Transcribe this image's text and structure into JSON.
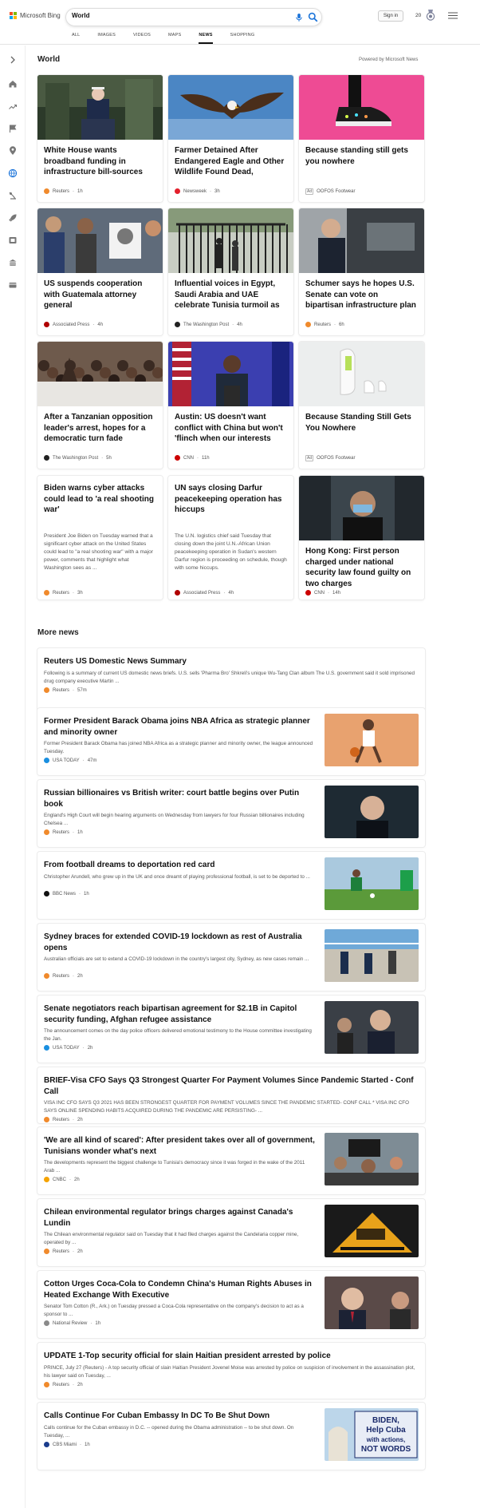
{
  "header": {
    "brand": "Microsoft Bing",
    "query": "World",
    "sign_in": "Sign in",
    "points": "20",
    "tabs": [
      {
        "label": "ALL",
        "active": false
      },
      {
        "label": "IMAGES",
        "active": false
      },
      {
        "label": "VIDEOS",
        "active": false
      },
      {
        "label": "MAPS",
        "active": false
      },
      {
        "label": "NEWS",
        "active": true
      },
      {
        "label": "SHOPPING",
        "active": false
      }
    ]
  },
  "sidebar": {
    "icons": [
      "expand-icon",
      "home-icon",
      "trending-icon",
      "flag-icon",
      "location-icon",
      "globe-icon",
      "science-icon",
      "rocket-icon",
      "film-icon",
      "building-icon",
      "card-icon"
    ],
    "active_index": 5
  },
  "world": {
    "heading": "World",
    "powered_by": "Powered by Microsoft News",
    "cards": [
      {
        "title": "White House wants broadband funding in infrastructure bill-sources",
        "source": "Reuters",
        "time": "1h",
        "badge": "#f08a2c",
        "image": "podium-speaker-image"
      },
      {
        "title": "Farmer Detained After Endangered Eagle and Other Wildlife Found Dead, Poisoned",
        "source": "Newsweek",
        "time": "3h",
        "badge": "#e3202c",
        "image": "eagle-image"
      },
      {
        "title": "Because standing still gets you nowhere",
        "source": "OOFOS Footwear",
        "time": "",
        "ad": "Ad",
        "image": "sneaker-image"
      },
      {
        "title": "US suspends cooperation with Guatemala attorney general",
        "source": "Associated Press",
        "time": "4h",
        "badge": "#b00000",
        "image": "protest-crowd-image"
      },
      {
        "title": "Influential voices in Egypt, Saudi Arabia and UAE celebrate Tunisia turmoil as blow to...",
        "source": "The Washington Post",
        "time": "4h",
        "badge": "#222222",
        "image": "gate-crowd-image"
      },
      {
        "title": "Schumer says he hopes U.S. Senate can vote on bipartisan infrastructure plan by week's...",
        "source": "Reuters",
        "time": "6h",
        "badge": "#f08a2c",
        "image": "senator-car-image"
      },
      {
        "title": "After a Tanzanian opposition leader's arrest, hopes for a democratic turn fade",
        "source": "The Washington Post",
        "time": "5h",
        "badge": "#222222",
        "image": "rally-crowd-image"
      },
      {
        "title": "Austin: US doesn't want conflict with China but won't 'flinch when our interests are...",
        "source": "CNN",
        "time": "11h",
        "badge": "#cc0000",
        "image": "general-flags-image"
      },
      {
        "title": "Because Standing Still Gets You Nowhere",
        "source": "OOFOS Footwear",
        "time": "",
        "ad": "Ad",
        "image": "white-shoes-image"
      },
      {
        "title": "Biden warns cyber attacks could lead to 'a real shooting war'",
        "desc": "President Joe Biden on Tuesday warned that a significant cyber attack on the United States could lead to \"a real shooting war\" with a major power, comments that highlight what Washington sees as ...",
        "source": "Reuters",
        "time": "3h",
        "badge": "#f08a2c"
      },
      {
        "title": "UN says closing Darfur peacekeeping operation has hiccups",
        "desc": "The U.N. logistics chief said Tuesday that closing down the joint U.N.-African Union peacekeeping operation in Sudan's western Darfur region is proceeding on schedule, though with some hiccups.",
        "source": "Associated Press",
        "time": "4h",
        "badge": "#b00000"
      },
      {
        "title": "Hong Kong: First person charged under national security law found guilty on two charges",
        "source": "CNN",
        "time": "14h",
        "badge": "#cc0000",
        "image": "masked-man-image"
      }
    ]
  },
  "more_news": {
    "heading": "More news",
    "items": [
      {
        "title": "Reuters US Domestic News Summary",
        "desc": "Following is a summary of current US domestic news briefs. U.S. sells 'Pharma Bro' Shkreli's unique Wu-Tang Clan album The U.S. government said it sold imprisoned drug company executive Martin ...",
        "source": "Reuters",
        "time": "57m",
        "badge": "#f08a2c"
      },
      {
        "title": "Former President Barack Obama joins NBA Africa as strategic planner and minority owner",
        "desc": "Former President Barack Obama has joined NBA Africa as a strategic planner and minority owner, the league announced Tuesday.",
        "source": "USA TODAY",
        "time": "47m",
        "badge": "#1a8fe0",
        "image": "basketball-image"
      },
      {
        "title": "Russian billionaires vs British writer: court battle begins over Putin book",
        "desc": "England's High Court will begin hearing arguments on Wednesday from lawyers for four Russian billionaires including Chelsea ...",
        "source": "Reuters",
        "time": "1h",
        "badge": "#f08a2c",
        "image": "billionaire-portrait-image"
      },
      {
        "title": "From football dreams to deportation red card",
        "desc": "Christopher Arundell, who grew up in the UK and once dreamt of playing professional football, is set to be deported to ...",
        "source": "BBC News",
        "time": "1h",
        "badge": "#111111",
        "image": "football-image"
      },
      {
        "title": "Sydney braces for extended COVID-19 lockdown as rest of Australia opens",
        "desc": "Australian officials are set to extend a COVID-19 lockdown in the country's largest city, Sydney, as new cases remain ...",
        "source": "Reuters",
        "time": "2h",
        "badge": "#f08a2c",
        "image": "beach-police-image"
      },
      {
        "title": "Senate negotiators reach bipartisan agreement for $2.1B in Capitol security funding, Afghan refugee assistance",
        "desc": "The announcement comes on the day police officers delivered emotional testimony to the House committee investigating the Jan.",
        "source": "USA TODAY",
        "time": "2h",
        "badge": "#1a8fe0",
        "image": "capitol-press-image"
      },
      {
        "title": "BRIEF-Visa CFO Says Q3 Strongest Quarter For Payment Volumes Since Pandemic Started - Conf Call",
        "desc": "VISA INC CFO SAYS Q3 2021 HAS BEEN STRONGEST QUARTER FOR PAYMENT VOLUMES SINCE THE PANDEMIC STARTED- CONF CALL * VISA INC CFO SAYS ONLINE SPENDING HABITS ACQUIRED DURING THE PANDEMIC ARE PERSISTING- ...",
        "source": "Reuters",
        "time": "2h",
        "badge": "#f08a2c"
      },
      {
        "title": "'We are all kind of scared': After president takes over all of government, Tunisians wonder what's next",
        "desc": "The developments represent the biggest challenge to Tunisia's democracy since it was forged in the wake of the 2011 Arab ...",
        "source": "CNBC",
        "time": "2h",
        "badge": "#f5a300",
        "image": "tunisia-protest-image"
      },
      {
        "title": "Chilean environmental regulator brings charges against Canada's Lundin",
        "desc": "The Chilean environmental regulator said on Tuesday that it had filed charges against the Candelaria copper mine, operated by ...",
        "source": "Reuters",
        "time": "2h",
        "badge": "#f08a2c",
        "image": "mine-truck-image"
      },
      {
        "title": "Cotton Urges Coca-Cola to Condemn China's Human Rights Abuses in Heated Exchange With Executive",
        "desc": "Senator Tom Cotton (R., Ark.) on Tuesday pressed a Coca-Cola representative on the company's decision to act as a sponsor to ...",
        "source": "National Review",
        "time": "1h",
        "badge": "#8a8a8a",
        "image": "senator-hearing-image"
      },
      {
        "title": "UPDATE 1-Top security official for slain Haitian president arrested by police",
        "desc": "PRINCE, July 27 (Reuters) - A top security official of slain Haitian President Jovenel Moise was arrested by police on suspicion of involvement in the assassination plot, his lawyer said on Tuesday, ...",
        "source": "Reuters",
        "time": "2h",
        "badge": "#f08a2c"
      },
      {
        "title": "Calls Continue For Cuban Embassy In DC To Be Shut Down",
        "desc": "Calls continue for the Cuban embassy in D.C. -- opened during the Obama administration -- to be shut down. On Tuesday, ...",
        "source": "CBS Miami",
        "time": "1h",
        "badge": "#1b3c8c",
        "image": "cuba-sign-image",
        "sign_text": [
          "BIDEN,",
          "Help Cuba",
          "with actions,",
          "NOT WORDS"
        ]
      }
    ]
  }
}
